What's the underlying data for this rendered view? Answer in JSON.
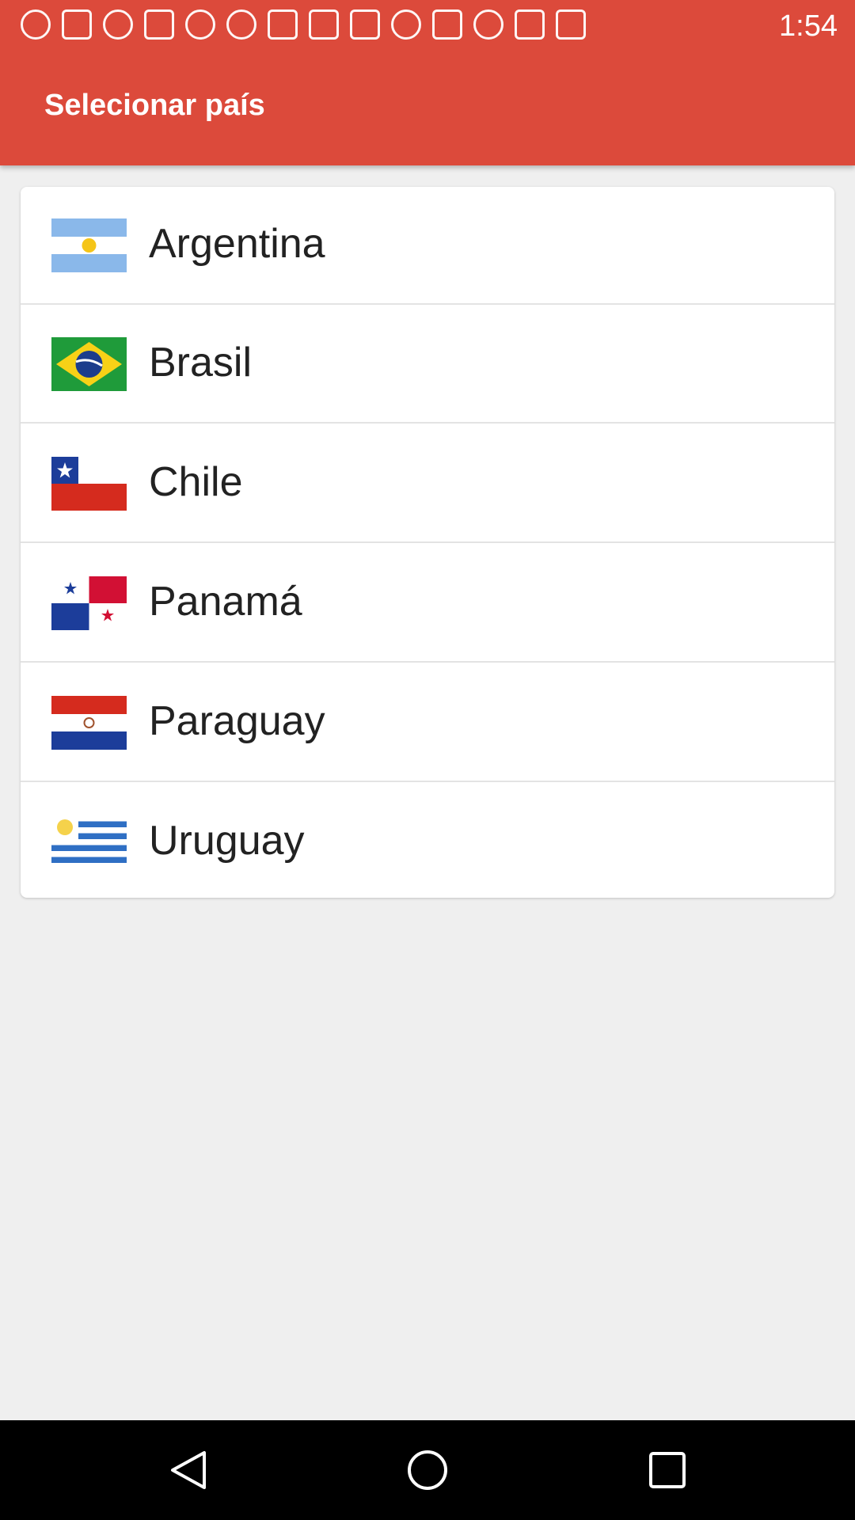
{
  "status_bar": {
    "time": "1:54",
    "icons": [
      "timer-icon",
      "wrench-icon",
      "smiley-icon",
      "facebook-icon",
      "smiley-icon",
      "smiley-icon",
      "alert-icon",
      "satellite-icon",
      "lock-icon",
      "android-icon",
      "smiley-icon",
      "bluetooth-icon",
      "alarm-icon",
      "signal-icon",
      "battery-icon"
    ]
  },
  "header": {
    "title": "Selecionar país"
  },
  "countries": [
    {
      "name": "Argentina",
      "flag": "argentina-flag-icon"
    },
    {
      "name": "Brasil",
      "flag": "brazil-flag-icon"
    },
    {
      "name": "Chile",
      "flag": "chile-flag-icon"
    },
    {
      "name": "Panamá",
      "flag": "panama-flag-icon"
    },
    {
      "name": "Paraguay",
      "flag": "paraguay-flag-icon"
    },
    {
      "name": "Uruguay",
      "flag": "uruguay-flag-icon"
    }
  ],
  "colors": {
    "appbar": "#dc4a3b",
    "background": "#efefef",
    "card": "#ffffff"
  }
}
